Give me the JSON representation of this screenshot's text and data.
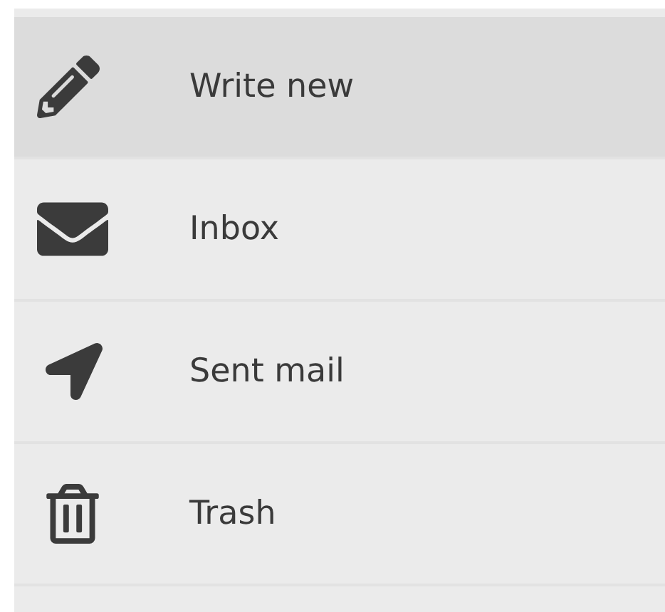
{
  "menu": {
    "items": [
      {
        "label": "Write new",
        "selected": true
      },
      {
        "label": "Inbox",
        "selected": false
      },
      {
        "label": "Sent mail",
        "selected": false
      },
      {
        "label": "Trash",
        "selected": false
      }
    ]
  }
}
